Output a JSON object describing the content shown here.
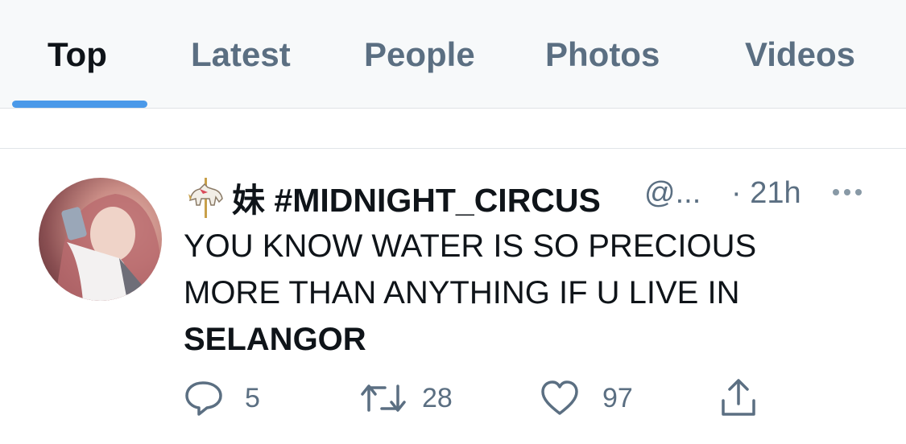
{
  "tabs": [
    {
      "label": "Top",
      "active": true
    },
    {
      "label": "Latest",
      "active": false
    },
    {
      "label": "People",
      "active": false
    },
    {
      "label": "Photos",
      "active": false
    },
    {
      "label": "Videos",
      "active": false
    }
  ],
  "tweet": {
    "avatar_icon": "user-avatar-photo",
    "name_emoji_icon": "carousel-horse-icon",
    "display_name": "妹 #MIDNIGHT_CIRCUS",
    "handle": "@...",
    "time": "· 21h",
    "text_line1": "YOU KNOW WATER IS SO PRECIOUS",
    "text_line2": "MORE THAN ANYTHING IF U LIVE IN",
    "text_line3": "SELANGOR",
    "replies": "5",
    "retweets": "28",
    "likes": "97"
  },
  "colors": {
    "accent": "#4a99e9",
    "text": "#0f1419",
    "muted": "#5b6f82"
  }
}
